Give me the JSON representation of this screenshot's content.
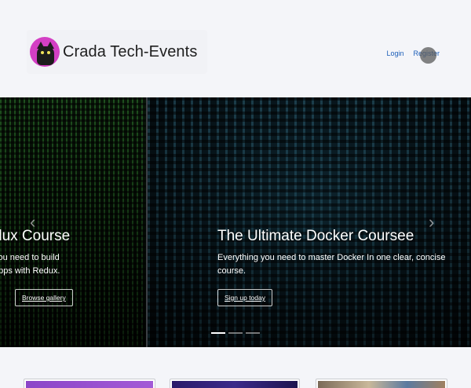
{
  "header": {
    "brand_name": "Crada Tech-Events",
    "nav": {
      "login": "Login",
      "register": "Register"
    }
  },
  "carousel": {
    "prev_arrow": "‹",
    "next_arrow": "›",
    "slides": [
      {
        "title": "dux Course",
        "text_line1": "you need to build",
        "text_line2": "apps with Redux.",
        "button": "Browse gallery"
      },
      {
        "title": "The Ultimate Docker Coursee",
        "text_line1": "Everything you need to master Docker In one clear, concise",
        "text_line2": "course.",
        "button": "Sign up today"
      }
    ],
    "indicators": {
      "count": 3,
      "active": 0
    }
  },
  "colors": {
    "accent": "#1a5db8",
    "logo_bg": "#d33fc4",
    "page_bg": "#f4f5f9"
  }
}
